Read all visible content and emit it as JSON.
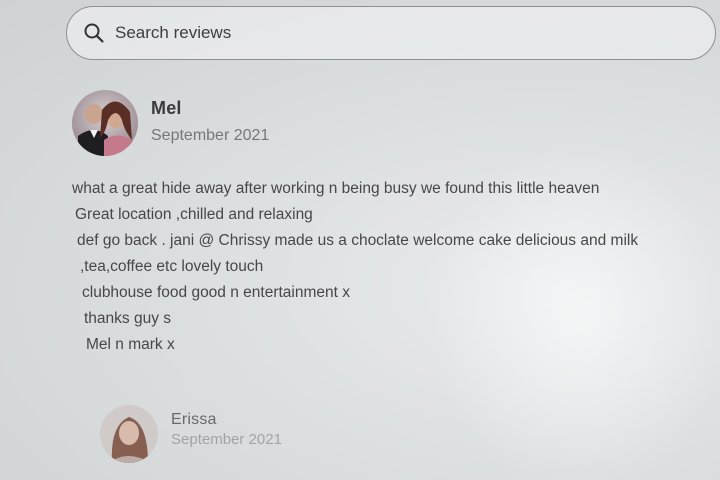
{
  "search": {
    "placeholder": "Search reviews",
    "icon": "search-icon"
  },
  "reviews": [
    {
      "name": "Mel",
      "date": "September 2021",
      "avatar": "avatar-photo",
      "lines": [
        "what a great hide away after working n being busy we found this little heaven",
        "Great location ,chilled and relaxing",
        "def go back . jani @ Chrissy made us a choclate welcome cake delicious and milk",
        ",tea,coffee etc lovely touch",
        "clubhouse food good n entertainment x",
        "thanks guy s",
        "Mel n mark x"
      ]
    },
    {
      "name": "Erissa",
      "date": "September 2021",
      "avatar": "avatar-photo"
    }
  ]
}
